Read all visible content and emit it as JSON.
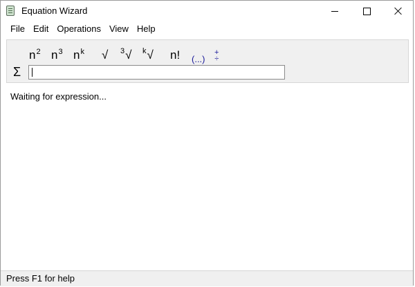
{
  "window": {
    "title": "Equation Wizard"
  },
  "menu": [
    "File",
    "Edit",
    "Operations",
    "View",
    "Help"
  ],
  "toolbar": {
    "square": {
      "base": "n",
      "exp": "2"
    },
    "cube": {
      "base": "n",
      "exp": "3"
    },
    "power": {
      "base": "n",
      "exp": "k"
    },
    "sqrt": "√",
    "cube_root": {
      "index": "3",
      "sign": "√"
    },
    "kth_root": {
      "index": "k",
      "sign": "√"
    },
    "factorial": "n!",
    "parentheses": "(...)",
    "fraction": {
      "top": "+",
      "bottom": "÷"
    }
  },
  "input": {
    "sigma": "Σ",
    "value": ""
  },
  "status_message": "Waiting for expression...",
  "statusbar": {
    "text": "Press F1 for help"
  },
  "colors": {
    "panel": "#f0f0f0",
    "accent_blue": "#1a1a9a"
  }
}
